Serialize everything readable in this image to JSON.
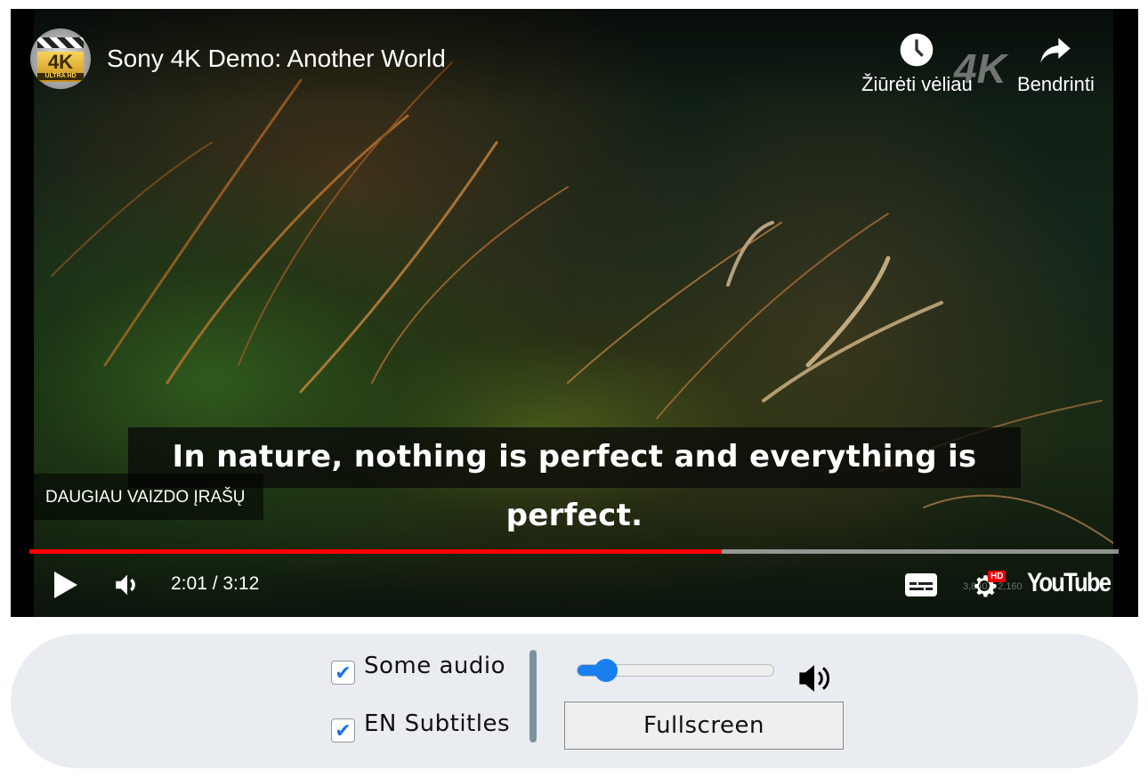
{
  "player": {
    "title": "Sony 4K Demo: Another World",
    "channel_logo_text": "4K ULTRA HD",
    "watermark": "4K",
    "watch_later_label": "Žiūrėti vėliau",
    "share_label": "Bendrinti",
    "caption": "In nature, nothing is perfect and everything is perfect.",
    "more_videos_label": "DAUGIAU VAIZDO ĮRAŠŲ",
    "current_time": "2:01",
    "duration": "3:12",
    "time_display": "2:01 / 3:12",
    "progress_percent": 63.6,
    "progress_color": "#ff0000",
    "stats_overlay": "3,840 x 2,160",
    "quality_badge": "HD",
    "brand": "YouTube",
    "icons": [
      "clock-icon",
      "share-arrow-icon",
      "play-icon",
      "volume-icon",
      "subtitles-icon",
      "settings-gear-icon"
    ]
  },
  "controls": {
    "audio_checkbox": {
      "label": "Some audio",
      "checked": true
    },
    "subtitles_checkbox": {
      "label": "EN Subtitles",
      "checked": true
    },
    "volume_percent": 10,
    "accent_color": "#1a7fee",
    "fullscreen_label": "Fullscreen"
  }
}
